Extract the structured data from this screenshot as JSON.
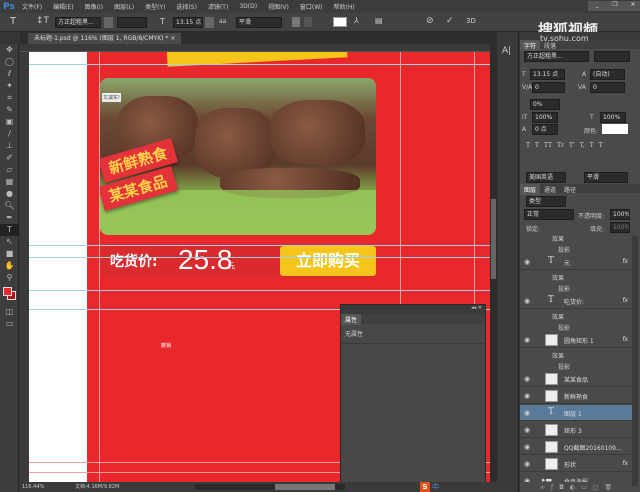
{
  "app": {
    "logo": "Ps",
    "menu": [
      "文件(F)",
      "编辑(E)",
      "图像(I)",
      "图层(L)",
      "类型(Y)",
      "选择(S)",
      "滤镜(T)",
      "3D(D)",
      "视图(V)",
      "窗口(W)",
      "帮助(H)"
    ]
  },
  "options": {
    "font": "方正超粗黑...",
    "size": "13.15 点",
    "antialias_icon": "aa",
    "antialias": "平滑"
  },
  "tab": {
    "title": "未标题-1.psd @ 116% (图层 1, RGB/8/CMYK) *"
  },
  "watermark": {
    "brand": "搜狐视频",
    "url": "tv.sohu.com"
  },
  "canvas": {
    "card_tag": "又减实!",
    "ribbon1": "新鲜熟食",
    "ribbon2": "某某食品",
    "price_label": "吃货价:",
    "price": "25.8",
    "price_unit": "元",
    "buy_button": "立即购买",
    "cursor_text": "撤销"
  },
  "properties": {
    "tab": "属性",
    "content": "无属性"
  },
  "character": {
    "tabs": [
      "字符",
      "段落"
    ],
    "font": "方正超粗黑...",
    "size": "13.15 点",
    "leading": "(自动)",
    "kerning": "0",
    "tracking": "0",
    "scale": "0%",
    "vscale": "100%",
    "hscale": "100%",
    "baseline": "0 点",
    "color_label": "颜色:",
    "color": "#ffffff",
    "styles": [
      "T",
      "T",
      "TT",
      "Tr",
      "T'",
      "T,",
      "T",
      "T"
    ],
    "language": "美国英语",
    "aa": "平滑"
  },
  "layers": {
    "tabs": [
      "图层",
      "通道",
      "路径"
    ],
    "filter": "类型",
    "blend": "正常",
    "opacity_label": "不透明度:",
    "opacity": "100%",
    "lock_label": "锁定:",
    "fill_label": "填充:",
    "fill": "100%",
    "items": [
      {
        "type": "sub",
        "label": "效果"
      },
      {
        "type": "sub2",
        "label": "投影"
      },
      {
        "type": "text",
        "name": "元",
        "fx": "fx"
      },
      {
        "type": "sub",
        "label": "效果"
      },
      {
        "type": "sub2",
        "label": "投影"
      },
      {
        "type": "text",
        "name": "吃货价:",
        "fx": "fx"
      },
      {
        "type": "sub",
        "label": "效果"
      },
      {
        "type": "sub2",
        "label": "投影"
      },
      {
        "type": "img",
        "name": "圆角矩形 1",
        "fx": "fx"
      },
      {
        "type": "sub",
        "label": "效果"
      },
      {
        "type": "sub2",
        "label": "投影"
      },
      {
        "type": "img",
        "name": "某某食品"
      },
      {
        "type": "img",
        "name": "新鲜熟食"
      },
      {
        "type": "text",
        "name": "图层 1",
        "selected": true
      },
      {
        "type": "img",
        "name": "矩形 3"
      },
      {
        "type": "img",
        "name": "QQ截图20160109..."
      },
      {
        "type": "img",
        "name": "形状",
        "fx": "fx"
      },
      {
        "type": "group",
        "name": "食品海报"
      }
    ]
  },
  "status": {
    "zoom": "116.44%",
    "doc": "文档:4.16M/9.82M"
  },
  "ime": {
    "label": "中"
  },
  "colors": {
    "fg": "#e8282a",
    "canvas_red": "#e8282a",
    "button": "#f6c51c"
  }
}
